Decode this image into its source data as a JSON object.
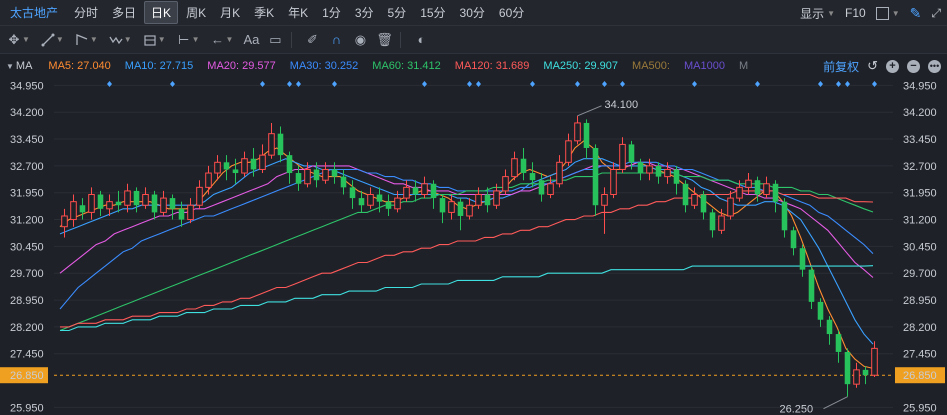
{
  "header": {
    "stock_name": "太古地产",
    "periods": [
      "分时",
      "多日",
      "日K",
      "周K",
      "月K",
      "季K",
      "年K",
      "1分",
      "3分",
      "5分",
      "15分",
      "30分",
      "60分"
    ],
    "active_period": "日K",
    "display_label": "显示",
    "f10_label": "F10"
  },
  "toolbar": {
    "text_tool_label": "Aa"
  },
  "ma_bar": {
    "label": "MA",
    "restore_label": "前复权",
    "items": [
      {
        "text": "MA5: 27.040",
        "color": "#ff8c32"
      },
      {
        "text": "MA10: 27.715",
        "color": "#3aa0ff"
      },
      {
        "text": "MA20: 29.577",
        "color": "#e45be4"
      },
      {
        "text": "MA30: 30.252",
        "color": "#3b8cff"
      },
      {
        "text": "MA60: 31.412",
        "color": "#2ec46a"
      },
      {
        "text": "MA120: 31.689",
        "color": "#ff5a5a"
      },
      {
        "text": "MA250: 29.907",
        "color": "#3fe0e0"
      },
      {
        "text": "MA500:",
        "color": "#9a7a3a"
      },
      {
        "text": "MA1000",
        "color": "#6a4fd0"
      },
      {
        "text": "M",
        "color": "#7a7f88"
      }
    ]
  },
  "chart_data": {
    "type": "candlestick",
    "y_ticks": [
      "34.950",
      "34.200",
      "33.450",
      "32.700",
      "31.950",
      "31.200",
      "30.450",
      "29.700",
      "28.950",
      "28.200",
      "27.450",
      "26.850",
      "25.950"
    ],
    "current_price": "26.850",
    "high_label": "34.100",
    "low_label": "26.250",
    "ylim": [
      25.85,
      35.1
    ],
    "up_color": "#ff4d4d",
    "down_color": "#27c25c",
    "candles": [
      [
        31.0,
        31.3,
        30.7,
        31.5
      ],
      [
        31.2,
        31.7,
        31.0,
        31.9
      ],
      [
        31.6,
        31.4,
        31.2,
        31.8
      ],
      [
        31.4,
        31.9,
        31.2,
        32.1
      ],
      [
        31.9,
        31.5,
        31.3,
        32.0
      ],
      [
        31.5,
        31.7,
        31.3,
        31.9
      ],
      [
        31.7,
        31.6,
        31.4,
        32.0
      ],
      [
        31.6,
        32.0,
        31.4,
        32.2
      ],
      [
        32.0,
        31.6,
        31.4,
        32.1
      ],
      [
        31.6,
        31.9,
        31.5,
        32.1
      ],
      [
        31.9,
        31.4,
        31.2,
        32.0
      ],
      [
        31.4,
        31.8,
        31.3,
        32.0
      ],
      [
        31.8,
        31.5,
        31.2,
        31.9
      ],
      [
        31.5,
        31.2,
        31.0,
        31.7
      ],
      [
        31.2,
        31.6,
        31.1,
        31.8
      ],
      [
        31.6,
        32.1,
        31.5,
        32.3
      ],
      [
        32.1,
        32.5,
        31.9,
        32.7
      ],
      [
        32.5,
        32.8,
        32.3,
        33.0
      ],
      [
        32.8,
        32.6,
        32.3,
        33.0
      ],
      [
        32.6,
        32.5,
        32.2,
        32.9
      ],
      [
        32.5,
        32.9,
        32.4,
        33.1
      ],
      [
        32.9,
        32.6,
        32.4,
        33.2
      ],
      [
        32.6,
        33.0,
        32.5,
        33.3
      ],
      [
        33.0,
        33.6,
        32.9,
        33.9
      ],
      [
        33.6,
        33.0,
        32.8,
        33.8
      ],
      [
        33.0,
        32.5,
        32.2,
        33.1
      ],
      [
        32.5,
        32.2,
        32.0,
        32.7
      ],
      [
        32.2,
        32.6,
        32.1,
        32.8
      ],
      [
        32.6,
        32.3,
        32.1,
        32.8
      ],
      [
        32.3,
        32.6,
        32.2,
        32.8
      ],
      [
        32.6,
        32.4,
        32.2,
        32.8
      ],
      [
        32.4,
        32.1,
        31.9,
        32.6
      ],
      [
        32.1,
        31.8,
        31.5,
        32.3
      ],
      [
        31.8,
        31.6,
        31.4,
        32.0
      ],
      [
        31.6,
        31.9,
        31.5,
        32.1
      ],
      [
        31.9,
        31.7,
        31.4,
        32.1
      ],
      [
        31.7,
        31.5,
        31.3,
        31.9
      ],
      [
        31.5,
        31.8,
        31.4,
        32.0
      ],
      [
        31.8,
        32.1,
        31.7,
        32.3
      ],
      [
        32.1,
        31.9,
        31.7,
        32.3
      ],
      [
        31.9,
        32.2,
        31.8,
        32.4
      ],
      [
        32.2,
        31.8,
        31.5,
        32.3
      ],
      [
        31.8,
        31.4,
        31.1,
        31.9
      ],
      [
        31.4,
        31.7,
        31.2,
        31.9
      ],
      [
        31.7,
        31.3,
        30.9,
        31.8
      ],
      [
        31.3,
        31.6,
        31.2,
        31.8
      ],
      [
        31.6,
        31.9,
        31.5,
        32.1
      ],
      [
        31.9,
        31.6,
        31.4,
        32.1
      ],
      [
        31.6,
        32.0,
        31.5,
        32.2
      ],
      [
        32.0,
        32.4,
        31.9,
        32.6
      ],
      [
        32.4,
        32.9,
        32.3,
        33.1
      ],
      [
        32.9,
        32.5,
        32.3,
        33.2
      ],
      [
        32.5,
        32.3,
        32.1,
        32.8
      ],
      [
        32.3,
        31.9,
        31.7,
        32.5
      ],
      [
        31.9,
        32.2,
        31.8,
        32.4
      ],
      [
        32.2,
        32.8,
        32.1,
        33.0
      ],
      [
        32.8,
        33.4,
        32.7,
        33.6
      ],
      [
        33.4,
        33.9,
        33.3,
        34.1
      ],
      [
        33.9,
        33.2,
        32.9,
        34.0
      ],
      [
        33.2,
        31.6,
        31.3,
        33.3
      ],
      [
        31.6,
        31.9,
        30.8,
        32.1
      ],
      [
        31.9,
        32.6,
        31.8,
        32.8
      ],
      [
        32.6,
        33.3,
        32.5,
        33.5
      ],
      [
        33.3,
        32.8,
        32.6,
        33.4
      ],
      [
        32.8,
        32.5,
        32.3,
        32.9
      ],
      [
        32.5,
        32.7,
        32.3,
        32.9
      ],
      [
        32.7,
        32.4,
        32.2,
        32.8
      ],
      [
        32.4,
        32.6,
        32.2,
        32.8
      ],
      [
        32.6,
        32.2,
        31.9,
        32.7
      ],
      [
        32.2,
        31.6,
        31.4,
        32.3
      ],
      [
        31.6,
        31.9,
        31.5,
        32.1
      ],
      [
        31.9,
        31.4,
        31.2,
        32.0
      ],
      [
        31.4,
        30.9,
        30.7,
        31.5
      ],
      [
        30.9,
        31.3,
        30.8,
        31.5
      ],
      [
        31.3,
        31.8,
        31.2,
        32.0
      ],
      [
        31.8,
        32.1,
        31.7,
        32.3
      ],
      [
        32.1,
        32.3,
        31.9,
        32.5
      ],
      [
        32.3,
        31.9,
        31.7,
        32.4
      ],
      [
        31.9,
        32.2,
        31.8,
        32.4
      ],
      [
        32.2,
        31.7,
        31.4,
        32.3
      ],
      [
        31.7,
        30.9,
        30.7,
        31.8
      ],
      [
        30.9,
        30.4,
        30.2,
        31.0
      ],
      [
        30.4,
        29.8,
        29.6,
        30.5
      ],
      [
        29.8,
        28.9,
        28.7,
        29.9
      ],
      [
        28.9,
        28.4,
        28.2,
        29.0
      ],
      [
        28.4,
        28.0,
        27.7,
        28.5
      ],
      [
        28.0,
        27.5,
        27.2,
        28.1
      ],
      [
        27.5,
        26.6,
        26.25,
        27.6
      ],
      [
        26.6,
        27.0,
        26.5,
        27.2
      ],
      [
        27.0,
        26.85,
        26.6,
        27.1
      ],
      [
        26.85,
        27.6,
        26.8,
        27.8
      ]
    ],
    "ma_lines": [
      {
        "name": "MA5",
        "color": "#ff8c32",
        "points": [
          31.0,
          31.2,
          31.3,
          31.4,
          31.5,
          31.6,
          31.6,
          31.7,
          31.7,
          31.7,
          31.7,
          31.6,
          31.5,
          31.5,
          31.5,
          31.6,
          31.9,
          32.2,
          32.5,
          32.7,
          32.8,
          32.8,
          32.9,
          33.1,
          33.2,
          33.0,
          32.8,
          32.6,
          32.5,
          32.4,
          32.4,
          32.4,
          32.2,
          32.0,
          31.9,
          31.8,
          31.7,
          31.7,
          31.8,
          31.9,
          32.0,
          32.0,
          31.9,
          31.8,
          31.6,
          31.5,
          31.6,
          31.7,
          31.8,
          32.0,
          32.3,
          32.5,
          32.6,
          32.5,
          32.4,
          32.5,
          32.8,
          33.2,
          33.4,
          33.2,
          32.8,
          32.6,
          32.6,
          32.7,
          32.8,
          32.7,
          32.6,
          32.5,
          32.4,
          32.2,
          32.0,
          31.8,
          31.6,
          31.4,
          31.3,
          31.4,
          31.6,
          31.8,
          32.0,
          32.0,
          31.7,
          31.3,
          30.7,
          30.0,
          29.3,
          28.7,
          28.2,
          27.6,
          27.3,
          27.1,
          27.04
        ]
      },
      {
        "name": "MA10",
        "color": "#3aa0ff",
        "points": [
          30.8,
          30.9,
          31.0,
          31.1,
          31.2,
          31.3,
          31.4,
          31.5,
          31.5,
          31.6,
          31.6,
          31.6,
          31.6,
          31.6,
          31.6,
          31.6,
          31.7,
          31.9,
          32.0,
          32.1,
          32.3,
          32.5,
          32.6,
          32.7,
          32.8,
          32.9,
          32.8,
          32.7,
          32.7,
          32.6,
          32.6,
          32.5,
          32.4,
          32.3,
          32.2,
          32.1,
          32.0,
          31.9,
          31.9,
          31.9,
          31.9,
          31.9,
          31.9,
          31.9,
          31.8,
          31.8,
          31.7,
          31.7,
          31.8,
          31.8,
          31.9,
          32.0,
          32.2,
          32.3,
          32.4,
          32.5,
          32.6,
          32.8,
          32.9,
          32.9,
          32.9,
          32.8,
          32.7,
          32.7,
          32.7,
          32.7,
          32.6,
          32.6,
          32.5,
          32.4,
          32.3,
          32.1,
          32.0,
          31.8,
          31.7,
          31.6,
          31.6,
          31.6,
          31.7,
          31.7,
          31.6,
          31.4,
          31.2,
          30.8,
          30.4,
          29.9,
          29.4,
          28.9,
          28.4,
          28.0,
          27.72
        ]
      },
      {
        "name": "MA20",
        "color": "#e45be4",
        "points": [
          29.7,
          29.9,
          30.1,
          30.3,
          30.5,
          30.6,
          30.8,
          30.9,
          31.0,
          31.1,
          31.2,
          31.3,
          31.3,
          31.4,
          31.4,
          31.5,
          31.5,
          31.6,
          31.7,
          31.8,
          31.9,
          32.0,
          32.1,
          32.2,
          32.4,
          32.5,
          32.6,
          32.6,
          32.7,
          32.7,
          32.7,
          32.7,
          32.7,
          32.6,
          32.5,
          32.4,
          32.3,
          32.2,
          32.2,
          32.1,
          32.1,
          32.0,
          32.0,
          32.0,
          31.9,
          31.9,
          31.9,
          31.9,
          31.9,
          31.9,
          31.9,
          32.0,
          32.0,
          32.1,
          32.2,
          32.3,
          32.4,
          32.5,
          32.6,
          32.7,
          32.7,
          32.7,
          32.7,
          32.7,
          32.8,
          32.8,
          32.7,
          32.7,
          32.6,
          32.6,
          32.5,
          32.4,
          32.3,
          32.2,
          32.1,
          32.0,
          31.9,
          31.9,
          31.8,
          31.8,
          31.7,
          31.6,
          31.5,
          31.3,
          31.1,
          30.9,
          30.6,
          30.3,
          30.0,
          29.8,
          29.58
        ]
      },
      {
        "name": "MA30",
        "color": "#3b8cff",
        "points": [
          28.7,
          29.0,
          29.3,
          29.5,
          29.7,
          29.9,
          30.1,
          30.3,
          30.4,
          30.6,
          30.7,
          30.8,
          30.9,
          31.0,
          31.1,
          31.2,
          31.3,
          31.3,
          31.4,
          31.5,
          31.6,
          31.7,
          31.8,
          31.9,
          32.0,
          32.1,
          32.2,
          32.3,
          32.4,
          32.5,
          32.6,
          32.6,
          32.6,
          32.6,
          32.5,
          32.5,
          32.4,
          32.4,
          32.3,
          32.3,
          32.2,
          32.2,
          32.1,
          32.1,
          32.0,
          32.0,
          32.0,
          32.0,
          32.0,
          32.0,
          32.0,
          32.1,
          32.1,
          32.2,
          32.2,
          32.3,
          32.4,
          32.5,
          32.6,
          32.6,
          32.7,
          32.7,
          32.7,
          32.8,
          32.8,
          32.8,
          32.8,
          32.7,
          32.7,
          32.6,
          32.6,
          32.5,
          32.4,
          32.3,
          32.3,
          32.2,
          32.1,
          32.1,
          32.0,
          32.0,
          31.9,
          31.8,
          31.7,
          31.6,
          31.4,
          31.3,
          31.1,
          30.9,
          30.7,
          30.5,
          30.25
        ]
      },
      {
        "name": "MA60",
        "color": "#2ec46a",
        "points": [
          28.1,
          28.2,
          28.3,
          28.4,
          28.5,
          28.6,
          28.7,
          28.8,
          28.9,
          29.0,
          29.1,
          29.2,
          29.3,
          29.4,
          29.5,
          29.6,
          29.7,
          29.8,
          29.9,
          30.0,
          30.1,
          30.2,
          30.3,
          30.4,
          30.5,
          30.6,
          30.7,
          30.8,
          30.9,
          31.0,
          31.1,
          31.2,
          31.3,
          31.4,
          31.4,
          31.5,
          31.6,
          31.6,
          31.7,
          31.7,
          31.8,
          31.8,
          31.9,
          31.9,
          31.9,
          32.0,
          32.0,
          32.0,
          32.1,
          32.1,
          32.1,
          32.2,
          32.2,
          32.2,
          32.3,
          32.3,
          32.3,
          32.4,
          32.4,
          32.4,
          32.5,
          32.5,
          32.5,
          32.5,
          32.5,
          32.5,
          32.5,
          32.5,
          32.5,
          32.4,
          32.4,
          32.4,
          32.3,
          32.3,
          32.3,
          32.2,
          32.2,
          32.2,
          32.2,
          32.1,
          32.1,
          32.1,
          32.0,
          32.0,
          31.9,
          31.9,
          31.8,
          31.7,
          31.6,
          31.5,
          31.41
        ]
      },
      {
        "name": "MA120",
        "color": "#ff5a5a",
        "points": [
          28.2,
          28.2,
          28.3,
          28.3,
          28.3,
          28.4,
          28.4,
          28.4,
          28.5,
          28.5,
          28.5,
          28.6,
          28.6,
          28.6,
          28.7,
          28.7,
          28.8,
          28.8,
          28.9,
          28.9,
          29.0,
          29.0,
          29.1,
          29.2,
          29.3,
          29.3,
          29.4,
          29.5,
          29.6,
          29.7,
          29.7,
          29.8,
          29.9,
          30.0,
          30.0,
          30.1,
          30.2,
          30.2,
          30.3,
          30.3,
          30.4,
          30.4,
          30.5,
          30.5,
          30.6,
          30.6,
          30.6,
          30.7,
          30.7,
          30.8,
          30.8,
          30.9,
          30.9,
          31.0,
          31.0,
          31.1,
          31.2,
          31.2,
          31.3,
          31.3,
          31.4,
          31.4,
          31.5,
          31.5,
          31.6,
          31.6,
          31.7,
          31.7,
          31.8,
          31.8,
          31.8,
          31.9,
          31.9,
          31.9,
          31.9,
          32.0,
          32.0,
          32.0,
          32.0,
          32.0,
          31.9,
          31.9,
          31.9,
          31.9,
          31.8,
          31.8,
          31.8,
          31.8,
          31.7,
          31.7,
          31.69
        ]
      },
      {
        "name": "MA250",
        "color": "#3fe0e0",
        "points": [
          28.1,
          28.1,
          28.2,
          28.2,
          28.2,
          28.3,
          28.3,
          28.3,
          28.4,
          28.4,
          28.4,
          28.5,
          28.5,
          28.5,
          28.6,
          28.6,
          28.6,
          28.7,
          28.7,
          28.7,
          28.8,
          28.8,
          28.8,
          28.9,
          28.9,
          28.9,
          29.0,
          29.0,
          29.0,
          29.1,
          29.1,
          29.1,
          29.2,
          29.2,
          29.2,
          29.2,
          29.3,
          29.3,
          29.3,
          29.3,
          29.4,
          29.4,
          29.4,
          29.4,
          29.5,
          29.5,
          29.5,
          29.5,
          29.5,
          29.6,
          29.6,
          29.6,
          29.6,
          29.6,
          29.7,
          29.7,
          29.7,
          29.7,
          29.7,
          29.7,
          29.7,
          29.8,
          29.8,
          29.8,
          29.8,
          29.8,
          29.8,
          29.8,
          29.8,
          29.8,
          29.9,
          29.9,
          29.9,
          29.9,
          29.9,
          29.9,
          29.9,
          29.9,
          29.9,
          29.9,
          29.9,
          29.9,
          29.9,
          29.9,
          29.9,
          29.9,
          29.9,
          29.9,
          29.9,
          29.9,
          29.91
        ]
      }
    ]
  }
}
